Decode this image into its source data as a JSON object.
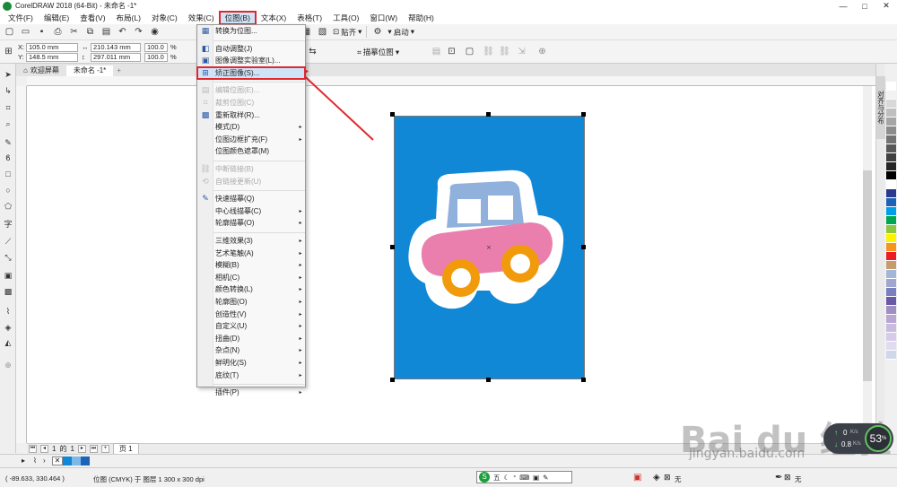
{
  "window": {
    "title": "CorelDRAW 2018 (64-Bit) - 未命名 -1*",
    "minimize": "—",
    "maximize": "□",
    "close": "✕"
  },
  "menubar": {
    "items": [
      "文件(F)",
      "编辑(E)",
      "查看(V)",
      "布局(L)",
      "对象(C)",
      "效果(C)",
      "位图(B)",
      "文本(X)",
      "表格(T)",
      "工具(O)",
      "窗口(W)",
      "帮助(H)"
    ]
  },
  "toolbar": {
    "snap_label": "贴齐",
    "launch_label": "启动",
    "trace_label": "描摹位图"
  },
  "propbar": {
    "x_label": "X:",
    "x_value": "105.0 mm",
    "y_label": "Y:",
    "y_value": "148.5 mm",
    "w_value": "210.143 mm",
    "h_value": "297.011 mm",
    "sx_value": "100.0",
    "sy_value": "100.0",
    "pct": "%"
  },
  "tabs": {
    "welcome": "欢迎屏幕",
    "doc": "未命名 -1*",
    "plus": "+"
  },
  "bitmap_menu": {
    "items": [
      {
        "label": "转换为位图...",
        "icon": "convert-icon",
        "glyph": "▦",
        "arrow": "",
        "disabled": false
      },
      {
        "sep": true
      },
      {
        "label": "自动调整(J)",
        "icon": "auto-adjust-icon",
        "glyph": "◧",
        "arrow": "",
        "disabled": false
      },
      {
        "label": "图像调整实验室(L)...",
        "icon": "image-lab-icon",
        "glyph": "▣",
        "arrow": "",
        "disabled": false
      },
      {
        "label": "矫正图像(S)...",
        "icon": "straighten-icon",
        "glyph": "⊞",
        "arrow": "",
        "disabled": false,
        "highlight": true
      },
      {
        "sep": true
      },
      {
        "label": "编辑位图(E)...",
        "icon": "edit-bitmap-icon",
        "glyph": "▤",
        "arrow": "",
        "disabled": true
      },
      {
        "label": "裁剪位图(C)",
        "icon": "crop-bitmap-icon",
        "glyph": "⌗",
        "arrow": "",
        "disabled": true
      },
      {
        "label": "重新取样(R)...",
        "icon": "resample-icon",
        "glyph": "▩",
        "arrow": "",
        "disabled": false
      },
      {
        "label": "模式(D)",
        "icon": "",
        "glyph": "",
        "arrow": "▸",
        "disabled": false
      },
      {
        "label": "位图边框扩充(F)",
        "icon": "",
        "glyph": "",
        "arrow": "▸",
        "disabled": false
      },
      {
        "label": "位图颜色遮罩(M)",
        "icon": "",
        "glyph": "",
        "arrow": "",
        "disabled": false
      },
      {
        "sep": true
      },
      {
        "label": "中断链接(B)",
        "icon": "break-link-icon",
        "glyph": "⛓",
        "arrow": "",
        "disabled": true
      },
      {
        "label": "自链接更新(U)",
        "icon": "update-link-icon",
        "glyph": "⟲",
        "arrow": "",
        "disabled": true
      },
      {
        "sep": true
      },
      {
        "label": "快速描摹(Q)",
        "icon": "quick-trace-icon",
        "glyph": "✎",
        "arrow": "",
        "disabled": false
      },
      {
        "label": "中心线描摹(C)",
        "icon": "",
        "glyph": "",
        "arrow": "▸",
        "disabled": false
      },
      {
        "label": "轮廓描摹(O)",
        "icon": "",
        "glyph": "",
        "arrow": "▸",
        "disabled": false
      },
      {
        "sep": true
      },
      {
        "label": "三维效果(3)",
        "icon": "",
        "glyph": "",
        "arrow": "▸",
        "disabled": false
      },
      {
        "label": "艺术笔触(A)",
        "icon": "",
        "glyph": "",
        "arrow": "▸",
        "disabled": false
      },
      {
        "label": "模糊(B)",
        "icon": "",
        "glyph": "",
        "arrow": "▸",
        "disabled": false
      },
      {
        "label": "相机(C)",
        "icon": "",
        "glyph": "",
        "arrow": "▸",
        "disabled": false
      },
      {
        "label": "颜色转换(L)",
        "icon": "",
        "glyph": "",
        "arrow": "▸",
        "disabled": false
      },
      {
        "label": "轮廓图(O)",
        "icon": "",
        "glyph": "",
        "arrow": "▸",
        "disabled": false
      },
      {
        "label": "创造性(V)",
        "icon": "",
        "glyph": "",
        "arrow": "▸",
        "disabled": false
      },
      {
        "label": "自定义(U)",
        "icon": "",
        "glyph": "",
        "arrow": "▸",
        "disabled": false
      },
      {
        "label": "扭曲(D)",
        "icon": "",
        "glyph": "",
        "arrow": "▸",
        "disabled": false
      },
      {
        "label": "杂点(N)",
        "icon": "",
        "glyph": "",
        "arrow": "▸",
        "disabled": false
      },
      {
        "label": "鲜明化(S)",
        "icon": "",
        "glyph": "",
        "arrow": "▸",
        "disabled": false
      },
      {
        "label": "底纹(T)",
        "icon": "",
        "glyph": "",
        "arrow": "▸",
        "disabled": false
      },
      {
        "sep": true
      },
      {
        "label": "插件(P)",
        "icon": "",
        "glyph": "",
        "arrow": "▸",
        "disabled": false
      }
    ]
  },
  "pagebar": {
    "page_num": "1",
    "page_of": "的",
    "page_total": "1",
    "page_tab": "页 1"
  },
  "status": {
    "coords": "( -89.633, 330.464 )",
    "object_info": "位图 (CMYK) 于 图层 1 300 x 300 dpi",
    "ime_label": "五",
    "fill_none": "无",
    "outline_none": "无"
  },
  "docker": {
    "tab_label": "对齐与分布"
  },
  "palette": {
    "colors": [
      "#ffffff",
      "#f2f2f2",
      "#d9d9d9",
      "#bfbfbf",
      "#a6a6a6",
      "#8c8c8c",
      "#737373",
      "#595959",
      "#404040",
      "#262626",
      "#000000",
      "#ffffff",
      "#2a3b8f",
      "#1c63b7",
      "#00a0e9",
      "#00a651",
      "#8dc63f",
      "#fff200",
      "#f7941d",
      "#ed1c24",
      "#c69c6d",
      "#a3b6d8",
      "#9fa6cf",
      "#7a7fbf",
      "#6a5aa6",
      "#9e8fc5",
      "#b9a6d3",
      "#c7bce0",
      "#d6cbe9",
      "#e2daf0",
      "#cfd7ea"
    ]
  },
  "watermark": {
    "brand": "Bai du 经验",
    "url": "jingyan.baidu.com"
  },
  "speed_widget": {
    "percent": "53",
    "pct_sign": "%",
    "up": "0",
    "up_unit": "K/s",
    "down": "0.8",
    "down_unit": "K/s"
  }
}
